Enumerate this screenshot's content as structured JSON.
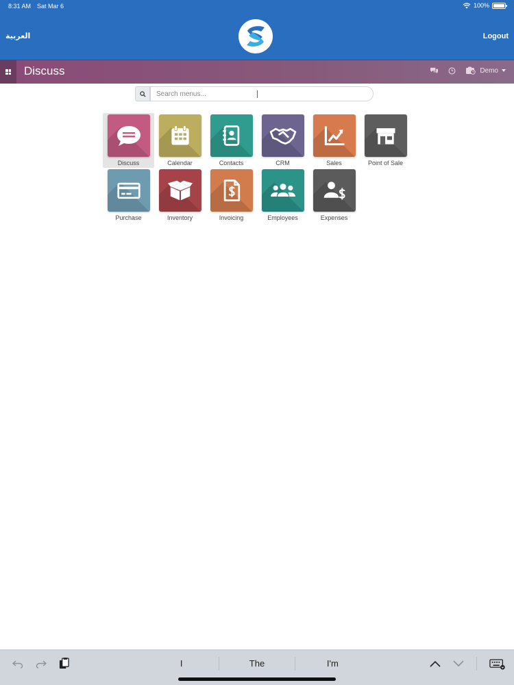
{
  "status_bar": {
    "time": "8:31 AM",
    "date": "Sat Mar 6",
    "battery": "100%"
  },
  "header": {
    "language_link": "العربية",
    "logout_label": "Logout"
  },
  "navbar": {
    "title": "Discuss",
    "user_label": "Demo"
  },
  "search": {
    "placeholder": "Search menus...",
    "value": ""
  },
  "apps": [
    {
      "label": "Discuss",
      "icon": "chat-bubble-icon",
      "color": "#c25a82",
      "active": true
    },
    {
      "label": "Calendar",
      "icon": "calendar-icon",
      "color": "#bcae5e",
      "active": false
    },
    {
      "label": "Contacts",
      "icon": "address-book-icon",
      "color": "#2f9c8f",
      "active": false
    },
    {
      "label": "CRM",
      "icon": "handshake-icon",
      "color": "#6d6590",
      "active": false
    },
    {
      "label": "Sales",
      "icon": "trend-chart-icon",
      "color": "#d77a4d",
      "active": false
    },
    {
      "label": "Point of Sale",
      "icon": "store-icon",
      "color": "#5d5d5d",
      "active": false
    },
    {
      "label": "Purchase",
      "icon": "credit-card-icon",
      "color": "#6f9bb1",
      "active": false
    },
    {
      "label": "Inventory",
      "icon": "box-icon",
      "color": "#a54348",
      "active": false
    },
    {
      "label": "Invoicing",
      "icon": "invoice-icon",
      "color": "#d27c4e",
      "active": false
    },
    {
      "label": "Employees",
      "icon": "people-icon",
      "color": "#2b9388",
      "active": false
    },
    {
      "label": "Expenses",
      "icon": "person-dollar-icon",
      "color": "#5b5b5b",
      "active": false
    }
  ],
  "keyboard_bar": {
    "suggestions": [
      "I",
      "The",
      "I'm"
    ]
  },
  "colors": {
    "header_blue": "#2a6ec0",
    "navbar_purple": "#875a7b"
  }
}
